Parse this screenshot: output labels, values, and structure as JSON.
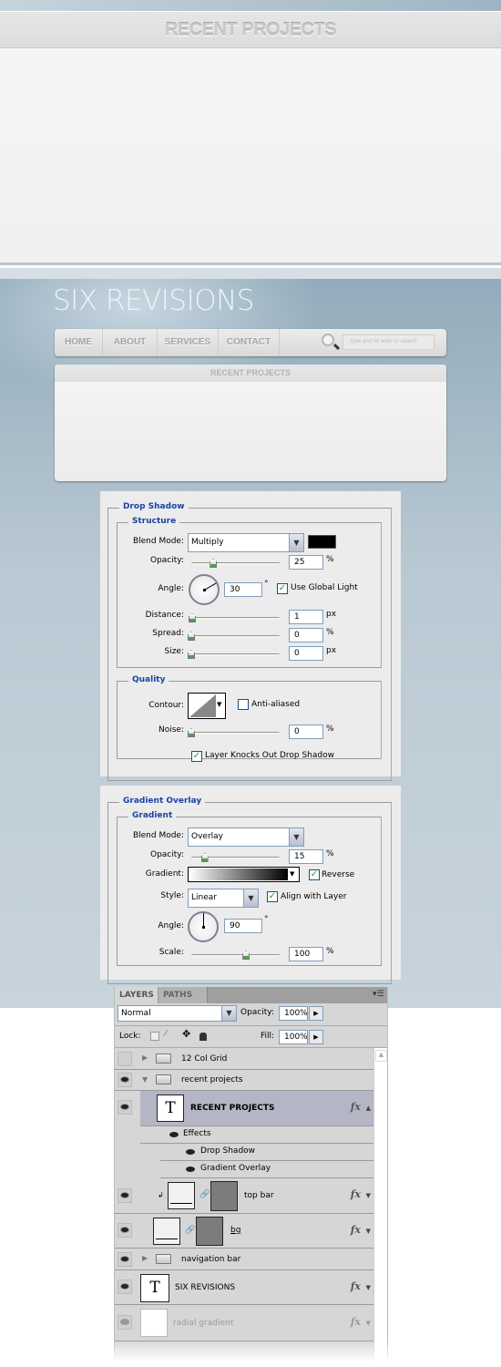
{
  "zoom_preview": {
    "title": "RECENT PROJECTS"
  },
  "site": {
    "logo": "SIX REVISIONS",
    "nav": [
      {
        "label": "HOME"
      },
      {
        "label": "ABOUT"
      },
      {
        "label": "SERVICES"
      },
      {
        "label": "CONTACT"
      }
    ],
    "search_placeholder": "type and hit enter to search",
    "recent_projects_title": "RECENT PROJECTS"
  },
  "drop_shadow": {
    "title": "Drop Shadow",
    "structure_title": "Structure",
    "blend_mode_label": "Blend Mode:",
    "blend_mode": "Multiply",
    "color": "#000000",
    "opacity_label": "Opacity:",
    "opacity": "25",
    "opacity_unit": "%",
    "opacity_slider": 25,
    "angle_label": "Angle:",
    "angle": "30",
    "angle_deg": 30,
    "degree": "°",
    "use_global_light": "Use Global Light",
    "use_global_light_checked": true,
    "distance_label": "Distance:",
    "distance": "1",
    "distance_unit": "px",
    "spread_label": "Spread:",
    "spread": "0",
    "spread_unit": "%",
    "size_label": "Size:",
    "size": "0",
    "size_unit": "px",
    "quality_title": "Quality",
    "contour_label": "Contour:",
    "anti_aliased": "Anti-aliased",
    "anti_aliased_checked": false,
    "noise_label": "Noise:",
    "noise": "0",
    "noise_unit": "%",
    "knockout": "Layer Knocks Out Drop Shadow",
    "knockout_checked": true
  },
  "gradient_overlay": {
    "title": "Gradient Overlay",
    "gradient_title": "Gradient",
    "blend_mode_label": "Blend Mode:",
    "blend_mode": "Overlay",
    "opacity_label": "Opacity:",
    "opacity": "15",
    "opacity_unit": "%",
    "gradient_label": "Gradient:",
    "reverse": "Reverse",
    "reverse_checked": true,
    "style_label": "Style:",
    "style": "Linear",
    "align": "Align with Layer",
    "align_checked": true,
    "angle_label": "Angle:",
    "angle": "90",
    "angle_deg": 90,
    "degree": "°",
    "scale_label": "Scale:",
    "scale": "100",
    "scale_unit": "%"
  },
  "layers_panel": {
    "tabs": [
      "LAYERS",
      "PATHS"
    ],
    "blend_mode": "Normal",
    "opacity_label": "Opacity:",
    "opacity": "100%",
    "lock_label": "Lock:",
    "fill_label": "Fill:",
    "fill": "100%",
    "layers": [
      {
        "name": "12 Col Grid",
        "type": "group",
        "visible": false
      },
      {
        "name": "recent projects",
        "type": "group",
        "visible": true,
        "expanded": true
      },
      {
        "name": "RECENT PROJECTS",
        "type": "text",
        "visible": true,
        "selected": true,
        "fx": true
      },
      {
        "name": "Effects"
      },
      {
        "name": "Drop Shadow"
      },
      {
        "name": "Gradient Overlay"
      },
      {
        "name": "top bar",
        "type": "masked",
        "visible": true,
        "fx": true
      },
      {
        "name": "bg",
        "type": "masked",
        "visible": true,
        "fx": true
      },
      {
        "name": "navigation bar",
        "type": "group",
        "visible": true
      },
      {
        "name": "SIX REVISIONS",
        "type": "text",
        "visible": true,
        "fx": true
      },
      {
        "name": "radial gradient",
        "type": "layer",
        "visible": true,
        "fx": true
      }
    ],
    "fx_label": "fx",
    "text_thumb": "T"
  }
}
